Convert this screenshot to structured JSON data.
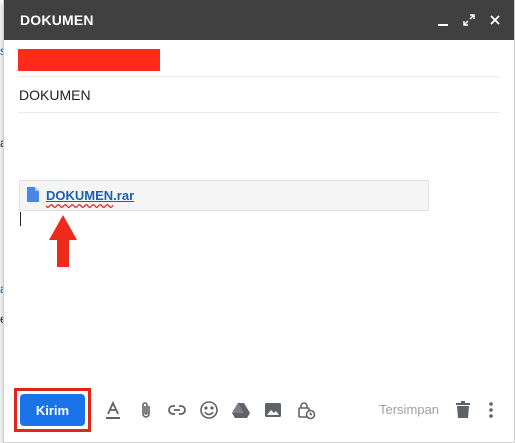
{
  "background": {
    "fragments": [
      "s",
      "a",
      "e"
    ]
  },
  "compose": {
    "title": "DOKUMEN",
    "subject": "DOKUMEN",
    "attachment": {
      "file_base": "DOKUMEN",
      "file_ext": ".rar",
      "icon": "file-icon"
    },
    "toolbar": {
      "send_label": "Kirim",
      "saved_status": "Tersimpan",
      "icons": [
        "format-text-icon",
        "attach-icon",
        "link-icon",
        "emoji-icon",
        "drive-icon",
        "photo-icon",
        "confidential-mode-icon",
        "trash-icon",
        "more-options-icon"
      ]
    },
    "window_buttons": [
      "minimize-icon",
      "fullscreen-icon",
      "close-icon"
    ]
  },
  "colors": {
    "titlebar": "#404040",
    "send_button": "#1a73e8",
    "annotation_red": "#e0251a",
    "link_blue": "#1a5fb4"
  }
}
